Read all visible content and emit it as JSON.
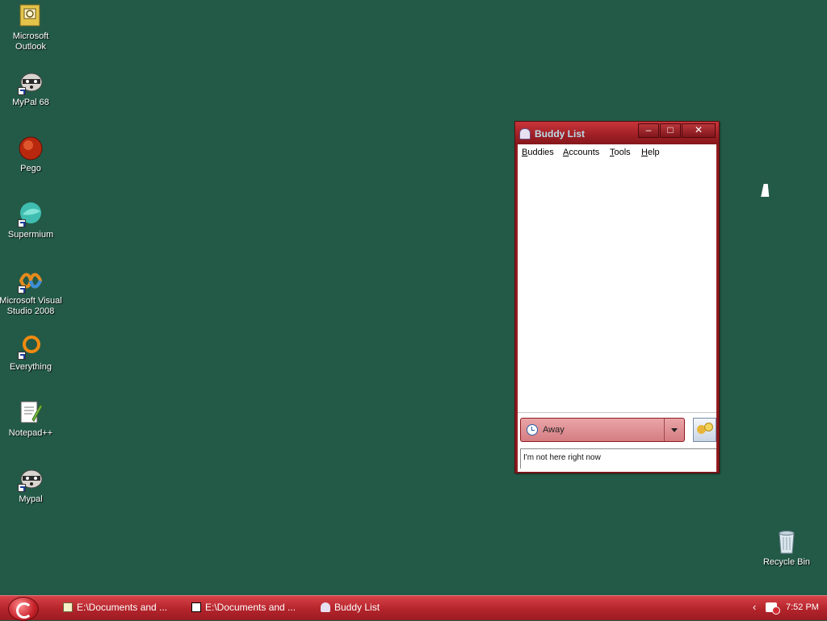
{
  "desktop": {
    "icons": [
      {
        "label": "Microsoft Outlook",
        "icon": "outlook-icon"
      },
      {
        "label": "MyPal 68",
        "icon": "raccoon-icon"
      },
      {
        "label": "Pego",
        "icon": "pego-icon"
      },
      {
        "label": "Supermium",
        "icon": "supermium-icon"
      },
      {
        "label": "Microsoft Visual Studio 2008",
        "icon": "visual-studio-icon"
      },
      {
        "label": "Everything",
        "icon": "everything-icon"
      },
      {
        "label": "Notepad++",
        "icon": "notepadpp-icon"
      },
      {
        "label": "Mypal",
        "icon": "raccoon-icon"
      },
      {
        "label": "Recycle Bin",
        "icon": "recycle-bin-icon"
      }
    ]
  },
  "window": {
    "title": "Buddy List",
    "controls": {
      "minimize": "–",
      "maximize": "□",
      "close": "✕"
    },
    "menu": [
      {
        "first": "B",
        "rest": "uddies"
      },
      {
        "first": "A",
        "rest": "ccounts"
      },
      {
        "first": "T",
        "rest": "ools"
      },
      {
        "first": "H",
        "rest": "elp"
      }
    ],
    "status": {
      "selected": "Away",
      "message": "I'm not here right now"
    }
  },
  "taskbar": {
    "tasks": [
      {
        "label": "E:\\Documents and ...",
        "icon": "notepad-icon"
      },
      {
        "label": "E:\\Documents and ...",
        "icon": "7zip-icon"
      },
      {
        "label": "Buddy List",
        "icon": "pidgin-icon"
      }
    ],
    "clock": "7:52 PM"
  },
  "colors": {
    "desktop": "#235a47",
    "window_frame": "#8f1b1f",
    "taskbar": "#b3242b"
  }
}
